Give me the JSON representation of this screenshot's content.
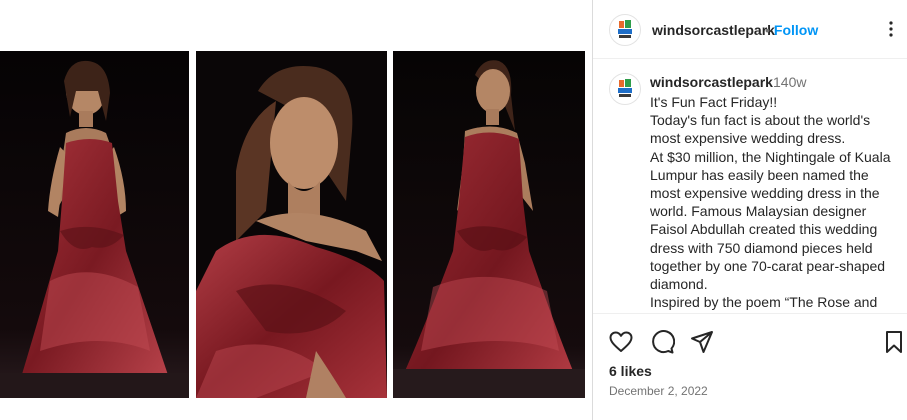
{
  "post": {
    "username": "windsorcastlepark",
    "separator": "•",
    "follow_label": "Follow",
    "time_ago": "140w",
    "caption": [
      "It's Fun Fact Friday!!",
      "Today's fun fact is about the world's most expensive wedding dress.",
      "At $30 million, the Nightingale of Kuala Lumpur has easily been named the most expensive wedding dress in the world. Famous Malaysian designer Faisol Abdullah created this wedding dress with 750 diamond pieces held together by one 70-carat pear-shaped diamond.",
      "Inspired by the poem “The Rose and the Nightingale,” the wedding dress"
    ],
    "likes": "6 likes",
    "date": "December 2, 2022"
  },
  "icons": {
    "more": "more-horizontal-icon",
    "like": "heart-icon",
    "comment": "comment-icon",
    "share": "paper-plane-icon",
    "save": "bookmark-icon"
  },
  "colors": {
    "link": "#0095f6",
    "text": "#262626",
    "secondary": "#737373",
    "dress": "#8a1f27"
  }
}
